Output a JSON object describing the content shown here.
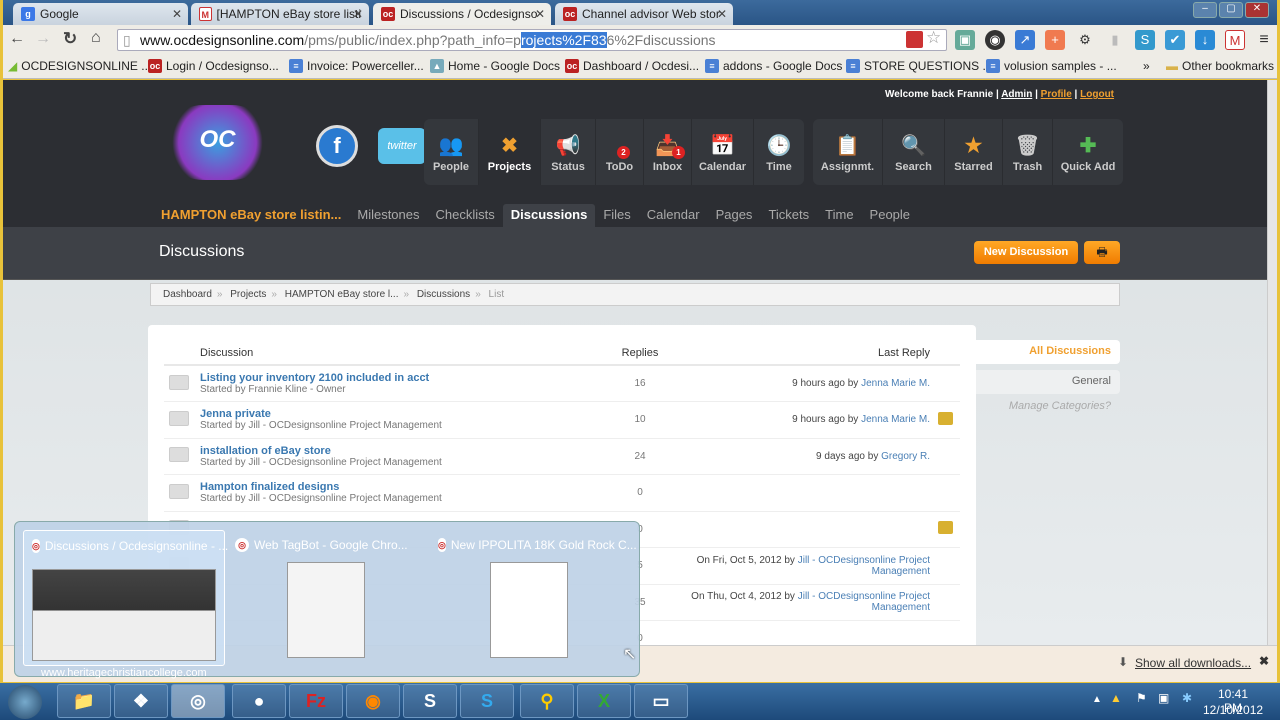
{
  "browser": {
    "tabs": [
      {
        "label": "Google",
        "icon": "google-icon"
      },
      {
        "label": "[HAMPTON eBay store listi",
        "icon": "gmail-icon"
      },
      {
        "label": "Discussions / Ocdesignso",
        "icon": "oc-icon",
        "active": true
      },
      {
        "label": "Channel advisor Web stor",
        "icon": "oc-icon"
      }
    ],
    "url": {
      "domain": "www.ocdesignsonline.com",
      "path_pre": "/pms/public/index.php?path_info=p",
      "path_sel": "rojects%2F83",
      "path_post": "6%2Fdiscussions"
    },
    "bookmarks": [
      "OCDESIGNSONLINE ...",
      "Login / Ocdesignso...",
      "Invoice: Powerceller...",
      "Home - Google Docs",
      "Dashboard / Ocdesi...",
      "addons - Google Docs",
      "STORE QUESTIONS ...",
      "volusion samples - ..."
    ],
    "bookmarks_more": "»",
    "other_bookmarks": "Other bookmarks"
  },
  "app": {
    "welcome": "Welcome back Frannie |",
    "admin": "Admin",
    "profile": "Profile",
    "logout": "Logout",
    "nav1": [
      {
        "label": "People",
        "icon": "👥"
      },
      {
        "label": "Projects",
        "icon": "✖"
      },
      {
        "label": "Status",
        "icon": "📢"
      },
      {
        "label": "ToDo",
        "icon": "",
        "badge": "2"
      },
      {
        "label": "Inbox",
        "icon": "📥",
        "badge": "1"
      },
      {
        "label": "Calendar",
        "icon": "📅"
      },
      {
        "label": "Time",
        "icon": "🕒"
      }
    ],
    "nav2": [
      {
        "label": "Assignmt.",
        "icon": "📋"
      },
      {
        "label": "Search",
        "icon": "🔍"
      },
      {
        "label": "Starred",
        "icon": "★"
      },
      {
        "label": "Trash",
        "icon": "🗑"
      },
      {
        "label": "Quick Add",
        "icon": "✚"
      }
    ],
    "project_name": "HAMPTON eBay store listin...",
    "subnav": [
      "Milestones",
      "Checklists",
      "Discussions",
      "Files",
      "Calendar",
      "Pages",
      "Tickets",
      "Time",
      "People"
    ],
    "page_title": "Discussions",
    "new_discussion": "New Discussion",
    "breadcrumb": [
      "Dashboard",
      "Projects",
      "HAMPTON eBay store l...",
      "Discussions",
      "List"
    ],
    "columns": {
      "discussion": "Discussion",
      "replies": "Replies",
      "last_reply": "Last Reply"
    },
    "rows": [
      {
        "title": "Listing your inventory 2100 included in acct",
        "started": "Started by Frannie Kline - Owner",
        "replies": "16",
        "last": "9 hours ago by ",
        "last_by": "Jenna Marie M."
      },
      {
        "title": "Jenna private",
        "started": "Started by Jill - OCDesignsonline Project Management",
        "replies": "10",
        "last": "9 hours ago by ",
        "last_by": "Jenna Marie M.",
        "box": true
      },
      {
        "title": "installation of eBay store",
        "started": "Started by Jill - OCDesignsonline Project Management",
        "replies": "24",
        "last": "9 days ago by ",
        "last_by": "Gregory R."
      },
      {
        "title": "Hampton finalized designs",
        "started": "Started by Jill - OCDesignsonline Project Management",
        "replies": "0",
        "last": "",
        "last_by": "",
        "read": true
      },
      {
        "title": "",
        "started": "",
        "replies": "0",
        "last": "",
        "last_by": "",
        "box": true
      },
      {
        "title": "",
        "started": "",
        "replies": "5",
        "last": "On Fri, Oct 5, 2012 by ",
        "last_by": "Jill - OCDesignsonline Project Management"
      },
      {
        "title": "",
        "started": "",
        "replies": "35",
        "last": "On Thu, Oct 4, 2012 by ",
        "last_by": "Jill - OCDesignsonline Project Management"
      },
      {
        "title": "",
        "started": "",
        "replies": "0",
        "last": "",
        "last_by": ""
      }
    ],
    "categories": {
      "all": "All Discussions",
      "general": "General",
      "manage": "Manage Categories?"
    }
  },
  "downloads": {
    "label": "Show all downloads..."
  },
  "peek": {
    "windows": [
      "Discussions / Ocdesignsonline - ...",
      "Web TagBot - Google Chro...",
      "New IPPOLITA 18K Gold Rock C..."
    ],
    "watermark": "www.heritagechristiancollege.com"
  },
  "taskbar": {
    "time": "10:41 PM",
    "date": "12/10/2012"
  }
}
